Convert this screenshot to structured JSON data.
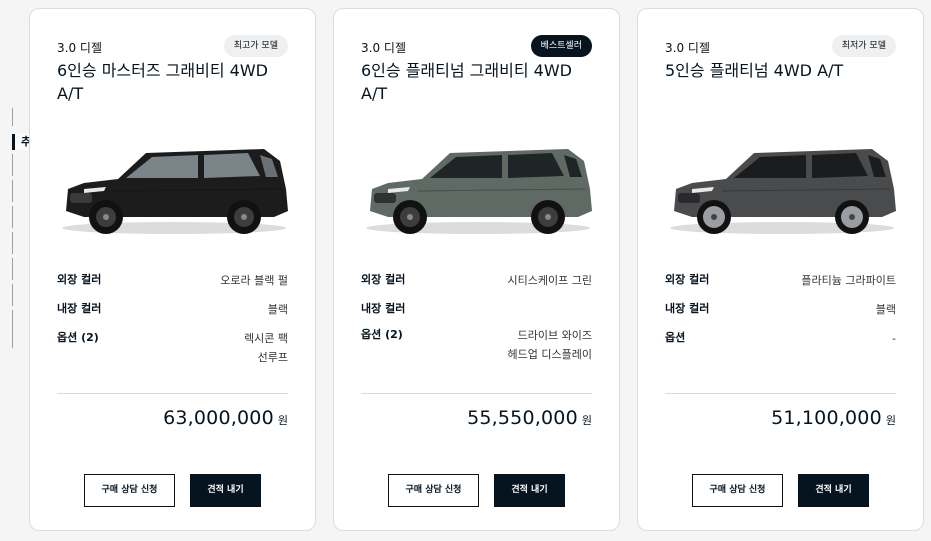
{
  "side_nav": {
    "label": "추천 모델"
  },
  "cards": [
    {
      "engine": "3.0 디젤",
      "badge": "최고가 모델",
      "title": "6인승 마스터즈 그래비티 4WD A/T",
      "car_icon": "suv-black-icon",
      "car_color": "#1c1c1c",
      "specs": {
        "exterior_label": "외장 컬러",
        "exterior_value": "오로라 블랙 펄",
        "interior_label": "내장 컬러",
        "interior_value": "블랙",
        "options_label": "옵션 (2)",
        "options_line1": "렉시콘 팩",
        "options_line2": "선루프"
      },
      "price": "63,000,000",
      "currency": "원",
      "consult_button": "구매 상담 신청",
      "quote_button": "견적 내기"
    },
    {
      "engine": "3.0 디젤",
      "badge": "베스트셀러",
      "title": "6인승 플래티넘 그래비티 4WD A/T",
      "car_icon": "suv-green-icon",
      "car_color": "#5f6a64",
      "specs": {
        "exterior_label": "외장 컬러",
        "exterior_value": "시티스케이프 그린",
        "interior_label": "내장 컬러",
        "interior_value": "",
        "options_label": "옵션 (2)",
        "options_line1": "드라이브 와이즈",
        "options_line2": "헤드업 디스플레이"
      },
      "price": "55,550,000",
      "currency": "원",
      "consult_button": "구매 상담 신청",
      "quote_button": "견적 내기"
    },
    {
      "engine": "3.0 디젤",
      "badge": "최저가 모델",
      "title": "5인승 플래티넘 4WD A/T",
      "car_icon": "suv-gray-icon",
      "car_color": "#4a4b4d",
      "specs": {
        "exterior_label": "외장 컬러",
        "exterior_value": "플라티늄 그라파이트",
        "interior_label": "내장 컬러",
        "interior_value": "블랙",
        "options_label": "옵션",
        "options_line1": "-",
        "options_line2": ""
      },
      "price": "51,100,000",
      "currency": "원",
      "consult_button": "구매 상담 신청",
      "quote_button": "견적 내기"
    }
  ]
}
